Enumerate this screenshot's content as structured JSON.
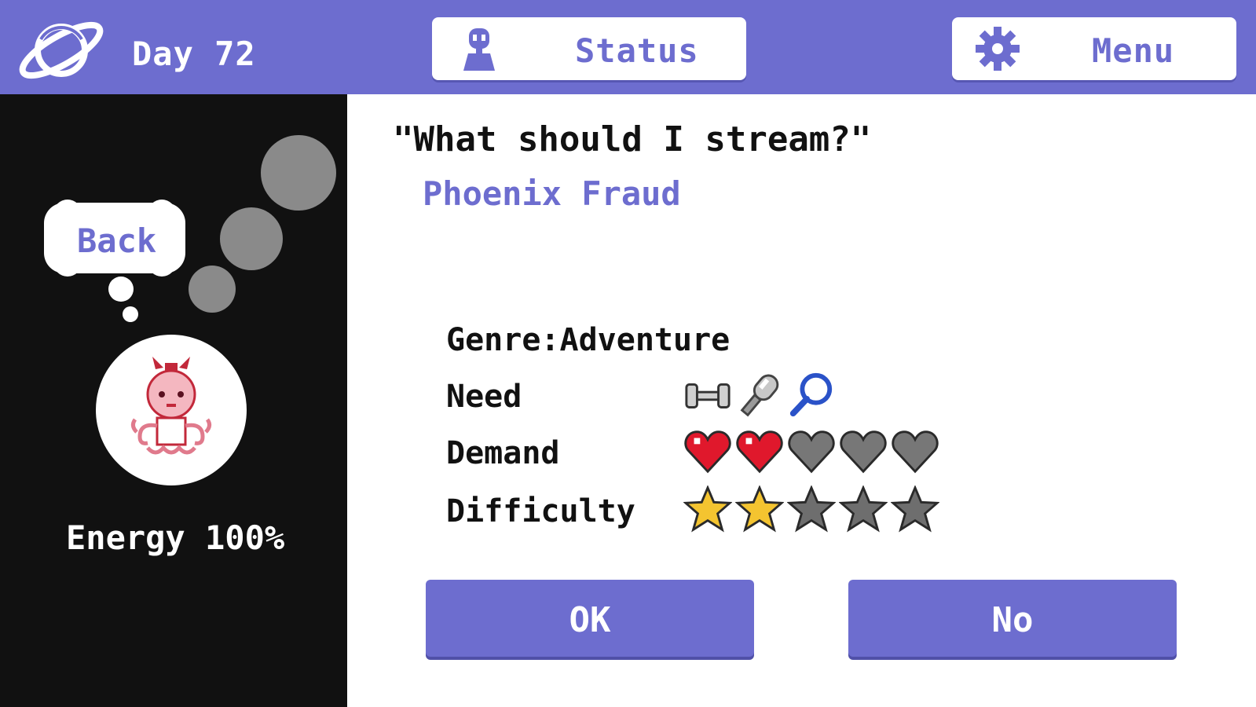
{
  "header": {
    "day_label": "Day 72",
    "status_label": "Status",
    "menu_label": "Menu",
    "accent_color": "#6d6dcf"
  },
  "sidebar": {
    "back_label": "Back",
    "energy_label": "Energy 100%"
  },
  "main": {
    "prompt": "\"What should I stream?\"",
    "game_title": "Phoenix Fraud",
    "genre_label": "Genre:Adventure",
    "need_label": "Need",
    "need_icons": [
      "dumbbell-icon",
      "microphone-icon",
      "magnifier-icon"
    ],
    "demand_label": "Demand",
    "demand_level": 2,
    "demand_max": 5,
    "difficulty_label": "Difficulty",
    "difficulty_level": 2,
    "difficulty_max": 5
  },
  "buttons": {
    "ok_label": "OK",
    "no_label": "No"
  }
}
